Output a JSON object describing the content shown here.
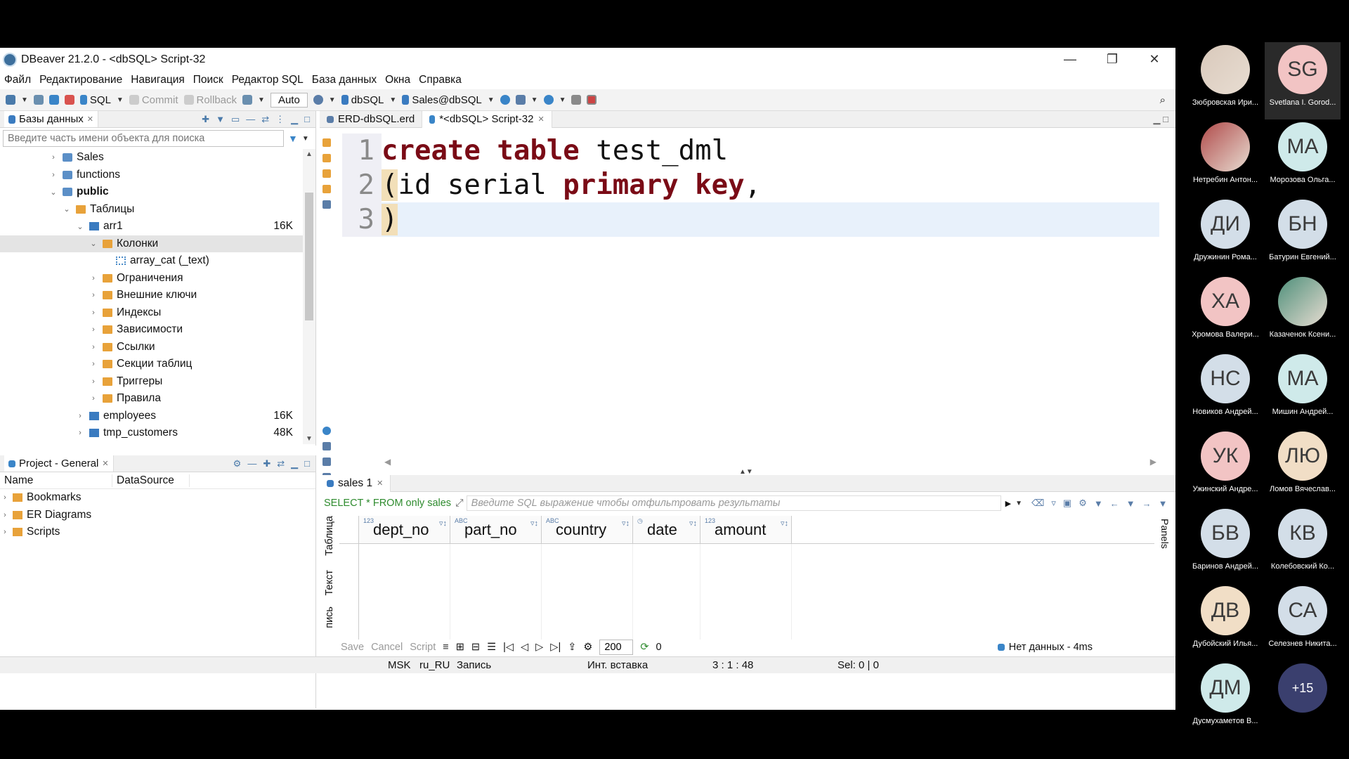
{
  "window": {
    "title": "DBeaver 21.2.0 - <dbSQL> Script-32",
    "controls": {
      "minimize": "—",
      "restore": "❐",
      "close": "✕"
    }
  },
  "menu": [
    "Файл",
    "Редактирование",
    "Навигация",
    "Поиск",
    "Редактор SQL",
    "База данных",
    "Окна",
    "Справка"
  ],
  "toolbar": {
    "sql": "SQL",
    "commit": "Commit",
    "rollback": "Rollback",
    "auto": "Auto",
    "datasource": "dbSQL",
    "schema": "Sales@dbSQL"
  },
  "db_panel": {
    "tab_label": "Базы данных",
    "search_placeholder": "Введите часть имени объекта для поиска",
    "tree": [
      {
        "label": "Sales",
        "indent": 1,
        "icon": "db",
        "arrow": "›"
      },
      {
        "label": "functions",
        "indent": 1,
        "icon": "db",
        "arrow": "›"
      },
      {
        "label": "public",
        "indent": 1,
        "icon": "db",
        "arrow": "⌄",
        "bold": true
      },
      {
        "label": "Таблицы",
        "indent": 2,
        "icon": "folder",
        "arrow": "⌄"
      },
      {
        "label": "arr1",
        "indent": 3,
        "icon": "table",
        "arrow": "⌄",
        "size": "16K"
      },
      {
        "label": "Колонки",
        "indent": 4,
        "icon": "folder",
        "arrow": "⌄",
        "selected": true
      },
      {
        "label": "array_cat (_text)",
        "indent": 5,
        "icon": "col",
        "arrow": ""
      },
      {
        "label": "Ограничения",
        "indent": 4,
        "icon": "folder",
        "arrow": "›"
      },
      {
        "label": "Внешние ключи",
        "indent": 4,
        "icon": "folder",
        "arrow": "›"
      },
      {
        "label": "Индексы",
        "indent": 4,
        "icon": "folder",
        "arrow": "›"
      },
      {
        "label": "Зависимости",
        "indent": 4,
        "icon": "folder",
        "arrow": "›"
      },
      {
        "label": "Ссылки",
        "indent": 4,
        "icon": "folder",
        "arrow": "›"
      },
      {
        "label": "Секции таблиц",
        "indent": 4,
        "icon": "folder",
        "arrow": "›"
      },
      {
        "label": "Триггеры",
        "indent": 4,
        "icon": "folder",
        "arrow": "›"
      },
      {
        "label": "Правила",
        "indent": 4,
        "icon": "folder",
        "arrow": "›"
      },
      {
        "label": "employees",
        "indent": 3,
        "icon": "table",
        "arrow": "›",
        "size": "16K"
      },
      {
        "label": "tmp_customers",
        "indent": 3,
        "icon": "table",
        "arrow": "›",
        "size": "48K"
      }
    ]
  },
  "project_panel": {
    "tab_label": "Project - General",
    "columns": [
      "Name",
      "DataSource"
    ],
    "items": [
      "Bookmarks",
      "ER Diagrams",
      "Scripts"
    ]
  },
  "editor": {
    "tabs": [
      {
        "label": "ERD-dbSQL.erd",
        "active": false
      },
      {
        "label": "*<dbSQL> Script-32",
        "active": true
      }
    ],
    "lines": [
      {
        "n": "1",
        "parts": [
          {
            "t": "create",
            "kw": true
          },
          {
            "t": " "
          },
          {
            "t": "table",
            "kw": true
          },
          {
            "t": " test_dml"
          }
        ]
      },
      {
        "n": "2",
        "parts": [
          {
            "t": "(",
            "paren": true
          },
          {
            "t": "id serial "
          },
          {
            "t": "primary",
            "kw": true
          },
          {
            "t": " "
          },
          {
            "t": "key",
            "kw": true
          },
          {
            "t": ","
          }
        ]
      },
      {
        "n": "3",
        "parts": [
          {
            "t": ")",
            "paren": true
          }
        ],
        "current": true
      }
    ]
  },
  "results": {
    "tab_label": "sales 1",
    "query": "SELECT * FROM only sales",
    "filter_placeholder": "Введите SQL выражение чтобы отфильтровать результаты",
    "side_tabs": [
      "Таблица",
      "Текст",
      "пись"
    ],
    "panels_label": "Panels",
    "columns": [
      {
        "name": "dept_no",
        "type": "123"
      },
      {
        "name": "part_no",
        "type": "ABC"
      },
      {
        "name": "country",
        "type": "ABC"
      },
      {
        "name": "date",
        "type": "◷"
      },
      {
        "name": "amount",
        "type": "123"
      }
    ],
    "toolbar": {
      "save": "Save",
      "cancel": "Cancel",
      "script": "Script",
      "fetch_size": "200",
      "count": "0",
      "status": "Нет данных - 4ms"
    }
  },
  "statusbar": {
    "tz": "MSK",
    "locale": "ru_RU",
    "mode": "Запись",
    "insert": "Инт. вставка",
    "position": "3 : 1 : 48",
    "sel": "Sel: 0 | 0"
  },
  "participants": [
    {
      "initials": "",
      "name": "Зюбровская Ири...",
      "photo": true,
      "bg": "#d9c9bb"
    },
    {
      "initials": "SG",
      "name": "Svetlana I. Gorod...",
      "bg": "#f2c4c4",
      "highlight": true
    },
    {
      "initials": "",
      "name": "Нетребин Антон...",
      "photo": true,
      "bg": "#b04a4a"
    },
    {
      "initials": "МА",
      "name": "Морозова Ольга...",
      "bg": "#cfeaea"
    },
    {
      "initials": "ДИ",
      "name": "Дружинин Рома...",
      "bg": "#d3dee8"
    },
    {
      "initials": "БН",
      "name": "Батурин Евгений...",
      "bg": "#d3dee8"
    },
    {
      "initials": "ХА",
      "name": "Хромова Валери...",
      "bg": "#f2c4c4"
    },
    {
      "initials": "",
      "name": "Казаченок Ксени...",
      "photo": true,
      "bg": "#4e8f7a"
    },
    {
      "initials": "НС",
      "name": "Новиков Андрей...",
      "bg": "#d3dee8"
    },
    {
      "initials": "МА",
      "name": "Мишин Андрей...",
      "bg": "#cfeaea"
    },
    {
      "initials": "УК",
      "name": "Ужинский Андре...",
      "bg": "#f2c4c4"
    },
    {
      "initials": "ЛЮ",
      "name": "Ломов Вячеслав...",
      "bg": "#f1dec6"
    },
    {
      "initials": "БВ",
      "name": "Баринов Андрей...",
      "bg": "#d3dee8"
    },
    {
      "initials": "КВ",
      "name": "Колебовский Ко...",
      "bg": "#d3dee8"
    },
    {
      "initials": "ДВ",
      "name": "Дубойский Илья...",
      "bg": "#f1dec6"
    },
    {
      "initials": "СА",
      "name": "Селезнев Никита...",
      "bg": "#d3dee8"
    },
    {
      "initials": "ДМ",
      "name": "Дусмухаметов В...",
      "bg": "#cfeaea"
    },
    {
      "initials": "+15",
      "name": "",
      "bg": "#3a3f6e",
      "light": true
    }
  ]
}
